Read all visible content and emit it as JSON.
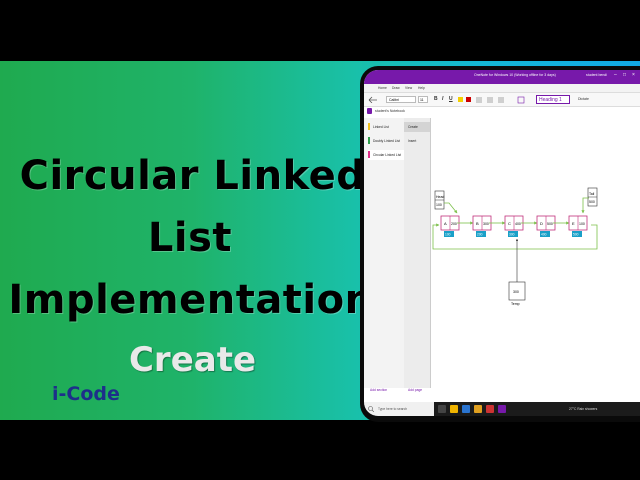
{
  "thumbnail": {
    "title_line1": "Circular Linked",
    "title_line2": "List",
    "title_line3": "Implementation",
    "subtitle": "Create",
    "brand": "i-Code"
  },
  "window": {
    "title": "OneNote for Windows 10 (Working offline for 3 days)",
    "user": "student bendi",
    "controls": [
      "–",
      "□",
      "×"
    ]
  },
  "menu": [
    "Home",
    "Draw",
    "View",
    "Help"
  ],
  "ribbon": {
    "font": "Calibri",
    "size": "11",
    "format_buttons": [
      "B",
      "I",
      "U"
    ],
    "style": "Heading 1",
    "dictate": "Dictate"
  },
  "notebook": {
    "name": "student's Notebook"
  },
  "sections": [
    {
      "label": "Linked List",
      "color": "#f0c020"
    },
    {
      "label": "Doubly Linked List",
      "color": "#2e9e4a"
    },
    {
      "label": "Circular Linked List",
      "color": "#e0308a"
    }
  ],
  "pages": [
    {
      "label": "Create",
      "selected": true
    },
    {
      "label": "Insert",
      "selected": false
    }
  ],
  "footer": {
    "add_section": "Add section",
    "add_page": "Add page"
  },
  "diagram": {
    "head": {
      "label": "Head",
      "value": "100"
    },
    "tail": {
      "label": "Tail",
      "value": "500"
    },
    "nodes": [
      {
        "data": "A",
        "next": "200",
        "addr": "100"
      },
      {
        "data": "B",
        "next": "300",
        "addr": "200"
      },
      {
        "data": "C",
        "next": "400",
        "addr": "300"
      },
      {
        "data": "D",
        "next": "500",
        "addr": "400"
      },
      {
        "data": "E",
        "next": "100",
        "addr": "500"
      }
    ],
    "temp": {
      "label": "Temp",
      "value": "300"
    },
    "colors": {
      "node_border": "#c0307a",
      "addr_box": "#1aa0c8",
      "arrow": "#7cc04a"
    }
  },
  "taskbar": {
    "search_placeholder": "Type here to search",
    "tray_text": "27°C  Rain showers"
  }
}
